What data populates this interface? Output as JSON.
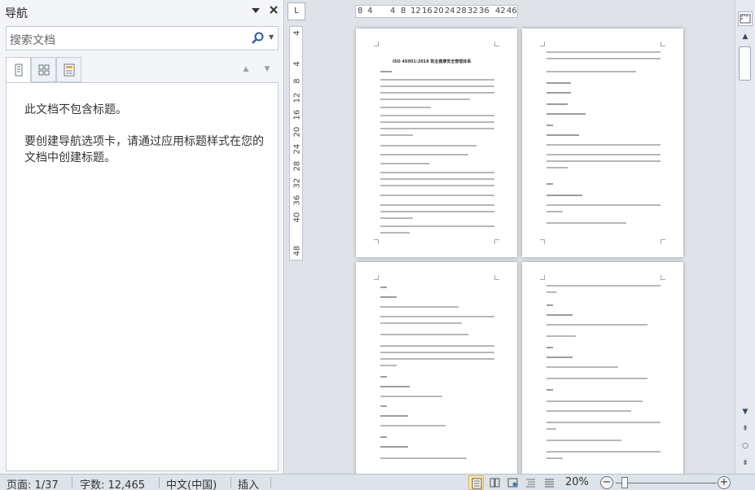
{
  "nav_pane": {
    "title": "导航",
    "menu_icon": "triangle-down-icon",
    "close_icon": "close-icon",
    "search_placeholder": "搜索文档",
    "search_icon": "magnifier-icon",
    "tabs": [
      {
        "name": "headings",
        "icon": "headings-icon",
        "active": true
      },
      {
        "name": "pages",
        "icon": "thumbnails-icon",
        "active": false
      },
      {
        "name": "results",
        "icon": "results-icon",
        "active": false
      }
    ],
    "message_no_headings": "此文档不包含标题。",
    "message_hint": "要创建导航选项卡，请通过应用标题样式在您的文档中创建标题。"
  },
  "rulers": {
    "horizontal_labels": [
      "8",
      "4",
      "4",
      "8",
      "12",
      "16",
      "20",
      "24",
      "28",
      "32",
      "36",
      "42",
      "46"
    ],
    "vertical_labels": [
      "4",
      "4",
      "8",
      "12",
      "16",
      "20",
      "24",
      "28",
      "32",
      "36",
      "40",
      "48"
    ]
  },
  "document": {
    "first_page_title": "ISO 45001:2018 职业健康安全管理体系"
  },
  "status_bar": {
    "page": "页面: 1/37",
    "word_count": "字数: 12,465",
    "language": "中文(中国)",
    "mode": "插入",
    "zoom": "20%",
    "zoom_percent": 20
  },
  "colors": {
    "pane_bg": "#f3f5f8",
    "doc_bg": "#dfe3e8",
    "status_bg": "#dde3ea",
    "active_view": "#fbe9a8"
  }
}
